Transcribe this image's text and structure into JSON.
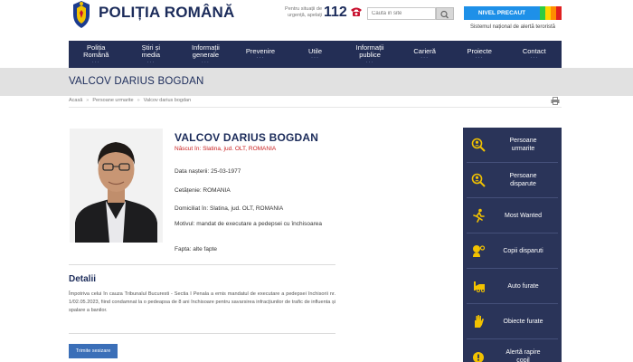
{
  "header": {
    "logo_text": "POLIȚIA ROMÂNĂ",
    "urgency_text": "Pentru situații de urgență, apelați",
    "urgency_number": "112",
    "search_placeholder": "Caută in site",
    "alert_level": "NIVEL PRECAUT",
    "alert_caption": "Sistemul național de alertă teroristă",
    "alert_colors": [
      "#1e90e8",
      "#2ecc40",
      "#ffd400",
      "#ff8c00",
      "#e02020"
    ]
  },
  "nav": [
    {
      "label": "Poliția\nRomână"
    },
    {
      "label": "Știri și\nmedia"
    },
    {
      "label": "Informații\ngenerale"
    },
    {
      "label": "Prevenire"
    },
    {
      "label": "Utile"
    },
    {
      "label": "Informații\npublice"
    },
    {
      "label": "Carieră"
    },
    {
      "label": "Proiecte"
    },
    {
      "label": "Contact"
    }
  ],
  "page": {
    "title": "VALCOV DARIUS BOGDAN",
    "breadcrumb": [
      "Acasă",
      "Persoane urmarite",
      "Valcov darius bogdan"
    ]
  },
  "person": {
    "name": "VALCOV DARIUS BOGDAN",
    "birthplace": "Născut în: Slatina, jud. OLT, ROMANIA",
    "birth_date": "Data nașterii: 25-03-1977",
    "citizenship": "Cetățenie: ROMANIA",
    "domicile": "Domiciliat în: Slatina, jud. OLT, ROMANIA",
    "motive": "Motivul: mandat de executare a pedepsei cu închisoarea",
    "offence": "Fapta: alte fapte"
  },
  "details": {
    "heading": "Detalii",
    "text": "Împotriva celui în cauza Tribunalul Bucuresti - Sectia I Penala a emis mandatul de executare a pedepsei închisorii nr. 1/02.05.2023, fiind condamnat la o pedeapsa de 8 ani închisoare pentru savarsirea infracțiunilor de trafic de influenta și spalare a banilor."
  },
  "send_button": "Trimite sesizare",
  "sidebar": [
    {
      "label": "Persoane\nurmarite",
      "icon": "search-person-icon"
    },
    {
      "label": "Persoane\ndisparute",
      "icon": "search-missing-icon"
    },
    {
      "label": "Most Wanted",
      "icon": "running-man-icon"
    },
    {
      "label": "Copii disparuti",
      "icon": "child-icon"
    },
    {
      "label": "Auto furate",
      "icon": "car-icon"
    },
    {
      "label": "Obiecte furate",
      "icon": "hand-icon"
    },
    {
      "label": "Alertă rapire\ncopil",
      "icon": "alert-icon"
    }
  ]
}
